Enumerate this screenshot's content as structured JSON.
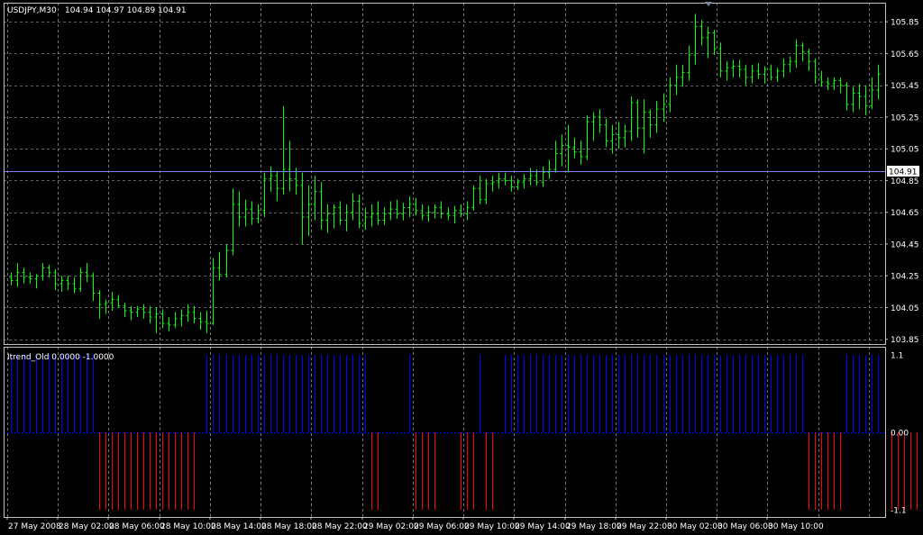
{
  "header": {
    "symbol_tf": "USDJPY,M30",
    "ohlc": "104.94 104.97 104.89 104.91"
  },
  "indicator": {
    "label": "Itrend_Old 0.0000 -1.0000"
  },
  "colors": {
    "background": "#000000",
    "grid": "#c0c0c0",
    "price_bars": "#00ff00",
    "up_histogram": "#0000ff",
    "down_histogram": "#ff0000",
    "bid_line": "#8080ff",
    "frame": "#c0c0c0"
  },
  "chart_data": [
    {
      "type": "ohlc",
      "current_price": "104.91",
      "y_ticks": [
        "105.85",
        "105.65",
        "105.45",
        "105.25",
        "105.05",
        "104.85",
        "104.65",
        "104.45",
        "104.25",
        "104.05",
        "103.85"
      ],
      "ylim": [
        103.82,
        105.97
      ],
      "x_ticks": [
        "27 May 2008",
        "28 May 02:00",
        "28 May 06:00",
        "28 May 10:00",
        "28 May 14:00",
        "28 May 18:00",
        "28 May 22:00",
        "29 May 02:00",
        "29 May 06:00",
        "29 May 10:00",
        "29 May 14:00",
        "29 May 18:00",
        "29 May 22:00",
        "30 May 02:00",
        "30 May 06:00",
        "30 May 10:00"
      ],
      "bars": [
        [
          104.24,
          104.27,
          104.19,
          104.22
        ],
        [
          104.22,
          104.33,
          104.18,
          104.27
        ],
        [
          104.27,
          104.3,
          104.2,
          104.24
        ],
        [
          104.24,
          104.27,
          104.2,
          104.23
        ],
        [
          104.23,
          104.26,
          104.17,
          104.25
        ],
        [
          104.25,
          104.33,
          104.22,
          104.3
        ],
        [
          104.3,
          104.32,
          104.24,
          104.27
        ],
        [
          104.27,
          104.29,
          104.16,
          104.2
        ],
        [
          104.2,
          104.25,
          104.15,
          104.22
        ],
        [
          104.22,
          104.25,
          104.16,
          104.2
        ],
        [
          104.2,
          104.24,
          104.14,
          104.17
        ],
        [
          104.17,
          104.3,
          104.15,
          104.27
        ],
        [
          104.27,
          104.33,
          104.21,
          104.25
        ],
        [
          104.25,
          104.27,
          104.09,
          104.14
        ],
        [
          104.14,
          104.16,
          103.98,
          104.07
        ],
        [
          104.07,
          104.1,
          104.01,
          104.08
        ],
        [
          104.08,
          104.15,
          104.03,
          104.1
        ],
        [
          104.1,
          104.13,
          104.05,
          104.06
        ],
        [
          104.06,
          104.08,
          103.99,
          104.03
        ],
        [
          104.03,
          104.06,
          103.97,
          104.02
        ],
        [
          104.02,
          104.06,
          103.99,
          104.04
        ],
        [
          104.04,
          104.07,
          103.98,
          104.02
        ],
        [
          104.02,
          104.06,
          103.95,
          103.99
        ],
        [
          103.99,
          104.05,
          103.89,
          104.01
        ],
        [
          104.01,
          104.04,
          103.92,
          103.95
        ],
        [
          103.95,
          103.99,
          103.9,
          103.94
        ],
        [
          103.94,
          104.02,
          103.92,
          103.98
        ],
        [
          103.98,
          104.04,
          103.93,
          104.0
        ],
        [
          104.0,
          104.07,
          103.96,
          104.02
        ],
        [
          104.02,
          104.06,
          103.95,
          103.98
        ],
        [
          103.98,
          104.02,
          103.91,
          103.96
        ],
        [
          103.96,
          104.03,
          103.89,
          103.95
        ],
        [
          103.95,
          104.36,
          103.94,
          104.3
        ],
        [
          104.3,
          104.4,
          104.22,
          104.26
        ],
        [
          104.26,
          104.45,
          104.24,
          104.41
        ],
        [
          104.41,
          104.8,
          104.38,
          104.7
        ],
        [
          104.7,
          104.78,
          104.56,
          104.62
        ],
        [
          104.62,
          104.73,
          104.56,
          104.67
        ],
        [
          104.67,
          104.72,
          104.57,
          104.61
        ],
        [
          104.61,
          104.7,
          104.58,
          104.66
        ],
        [
          104.66,
          104.9,
          104.62,
          104.86
        ],
        [
          104.86,
          104.94,
          104.78,
          104.88
        ],
        [
          104.88,
          104.91,
          104.72,
          104.8
        ],
        [
          104.8,
          105.32,
          104.76,
          104.92
        ],
        [
          104.92,
          105.1,
          104.78,
          104.86
        ],
        [
          104.86,
          104.93,
          104.76,
          104.82
        ],
        [
          104.82,
          104.9,
          104.45,
          104.62
        ],
        [
          104.62,
          104.82,
          104.5,
          104.7
        ],
        [
          104.7,
          104.88,
          104.6,
          104.78
        ],
        [
          104.78,
          104.84,
          104.54,
          104.6
        ],
        [
          104.6,
          104.7,
          104.52,
          104.64
        ],
        [
          104.64,
          104.7,
          104.55,
          104.68
        ],
        [
          104.68,
          104.72,
          104.57,
          104.6
        ],
        [
          104.6,
          104.7,
          104.53,
          104.65
        ],
        [
          104.65,
          104.77,
          104.6,
          104.72
        ],
        [
          104.72,
          104.76,
          104.55,
          104.58
        ],
        [
          104.58,
          104.68,
          104.54,
          104.62
        ],
        [
          104.62,
          104.7,
          104.56,
          104.64
        ],
        [
          104.64,
          104.72,
          104.57,
          104.6
        ],
        [
          104.6,
          104.68,
          104.57,
          104.64
        ],
        [
          104.64,
          104.72,
          104.6,
          104.67
        ],
        [
          104.67,
          104.73,
          104.61,
          104.64
        ],
        [
          104.64,
          104.71,
          104.6,
          104.68
        ],
        [
          104.68,
          104.75,
          104.62,
          104.7
        ],
        [
          104.7,
          104.74,
          104.63,
          104.66
        ],
        [
          104.66,
          104.7,
          104.6,
          104.63
        ],
        [
          104.63,
          104.69,
          104.59,
          104.65
        ],
        [
          104.65,
          104.7,
          104.61,
          104.68
        ],
        [
          104.68,
          104.72,
          104.61,
          104.64
        ],
        [
          104.64,
          104.68,
          104.6,
          104.63
        ],
        [
          104.63,
          104.69,
          104.58,
          104.66
        ],
        [
          104.66,
          104.7,
          104.62,
          104.64
        ],
        [
          104.64,
          104.72,
          104.6,
          104.68
        ],
        [
          104.68,
          104.82,
          104.66,
          104.8
        ],
        [
          104.8,
          104.88,
          104.7,
          104.73
        ],
        [
          104.73,
          104.86,
          104.7,
          104.83
        ],
        [
          104.83,
          104.88,
          104.78,
          104.84
        ],
        [
          104.84,
          104.9,
          104.8,
          104.86
        ],
        [
          104.86,
          104.9,
          104.82,
          104.85
        ],
        [
          104.85,
          104.88,
          104.78,
          104.81
        ],
        [
          104.81,
          104.86,
          104.79,
          104.84
        ],
        [
          104.84,
          104.89,
          104.8,
          104.86
        ],
        [
          104.86,
          104.93,
          104.82,
          104.88
        ],
        [
          104.88,
          104.92,
          104.82,
          104.84
        ],
        [
          104.84,
          104.94,
          104.81,
          104.9
        ],
        [
          104.9,
          104.98,
          104.86,
          104.92
        ],
        [
          104.92,
          105.1,
          104.9,
          105.02
        ],
        [
          105.02,
          105.14,
          104.94,
          105.07
        ],
        [
          105.07,
          105.2,
          104.9,
          105.06
        ],
        [
          105.06,
          105.12,
          104.99,
          105.03
        ],
        [
          105.03,
          105.1,
          104.95,
          105.0
        ],
        [
          105.0,
          105.26,
          104.98,
          105.22
        ],
        [
          105.22,
          105.28,
          105.1,
          105.25
        ],
        [
          105.25,
          105.3,
          105.15,
          105.2
        ],
        [
          105.2,
          105.24,
          105.06,
          105.1
        ],
        [
          105.1,
          105.2,
          105.02,
          105.14
        ],
        [
          105.14,
          105.22,
          105.05,
          105.12
        ],
        [
          105.12,
          105.2,
          105.06,
          105.16
        ],
        [
          105.16,
          105.38,
          105.1,
          105.34
        ],
        [
          105.34,
          105.36,
          105.12,
          105.18
        ],
        [
          105.18,
          105.36,
          105.02,
          105.28
        ],
        [
          105.28,
          105.3,
          105.12,
          105.2
        ],
        [
          105.2,
          105.35,
          105.15,
          105.3
        ],
        [
          105.3,
          105.4,
          105.22,
          105.33
        ],
        [
          105.33,
          105.5,
          105.28,
          105.45
        ],
        [
          105.45,
          105.58,
          105.39,
          105.5
        ],
        [
          105.5,
          105.58,
          105.44,
          105.53
        ],
        [
          105.53,
          105.7,
          105.48,
          105.64
        ],
        [
          105.64,
          105.9,
          105.58,
          105.82
        ],
        [
          105.82,
          105.86,
          105.7,
          105.75
        ],
        [
          105.75,
          105.82,
          105.62,
          105.78
        ],
        [
          105.78,
          105.8,
          105.64,
          105.68
        ],
        [
          105.68,
          105.72,
          105.5,
          105.54
        ],
        [
          105.54,
          105.6,
          105.48,
          105.56
        ],
        [
          105.56,
          105.61,
          105.5,
          105.57
        ],
        [
          105.57,
          105.61,
          105.5,
          105.55
        ],
        [
          105.55,
          105.58,
          105.45,
          105.5
        ],
        [
          105.5,
          105.58,
          105.46,
          105.54
        ],
        [
          105.54,
          105.59,
          105.49,
          105.52
        ],
        [
          105.52,
          105.57,
          105.46,
          105.55
        ],
        [
          105.55,
          105.58,
          105.48,
          105.5
        ],
        [
          105.5,
          105.56,
          105.47,
          105.54
        ],
        [
          105.54,
          105.62,
          105.5,
          105.58
        ],
        [
          105.58,
          105.63,
          105.53,
          105.6
        ],
        [
          105.6,
          105.74,
          105.56,
          105.7
        ],
        [
          105.7,
          105.72,
          105.6,
          105.66
        ],
        [
          105.66,
          105.68,
          105.54,
          105.6
        ],
        [
          105.6,
          105.62,
          105.46,
          105.5
        ],
        [
          105.5,
          105.54,
          105.44,
          105.47
        ],
        [
          105.47,
          105.5,
          105.42,
          105.46
        ],
        [
          105.46,
          105.5,
          105.42,
          105.48
        ],
        [
          105.48,
          105.5,
          105.4,
          105.45
        ],
        [
          105.45,
          105.47,
          105.29,
          105.33
        ],
        [
          105.33,
          105.44,
          105.28,
          105.4
        ],
        [
          105.4,
          105.46,
          105.3,
          105.38
        ],
        [
          105.38,
          105.45,
          105.26,
          105.32
        ],
        [
          105.32,
          105.5,
          105.3,
          105.42
        ],
        [
          105.42,
          105.58,
          105.36,
          105.52
        ]
      ],
      "trend": [
        1,
        1,
        1,
        1,
        1,
        1,
        1,
        1,
        1,
        1,
        1,
        1,
        1,
        1,
        -1,
        -1,
        -1,
        -1,
        -1,
        -1,
        -1,
        -1,
        -1,
        -1,
        -1,
        -1,
        -1,
        -1,
        -1,
        -1,
        0,
        1,
        1,
        1,
        1,
        1,
        1,
        1,
        1,
        1,
        1,
        1,
        1,
        1,
        1,
        1,
        1,
        1,
        1,
        1,
        1,
        1,
        1,
        1,
        1,
        1,
        1,
        -1,
        -1,
        0,
        0,
        0,
        0,
        1,
        -1,
        -1,
        -1,
        -1,
        0,
        0,
        0,
        -1,
        -1,
        -1,
        1,
        -1,
        -1,
        0,
        1,
        1,
        1,
        1,
        1,
        1,
        1,
        1,
        1,
        1,
        1,
        1,
        1,
        1,
        1,
        1,
        1,
        1,
        1,
        1,
        1,
        1,
        1,
        1,
        1,
        1,
        1,
        1,
        1,
        1,
        1,
        1,
        1,
        1,
        1,
        1,
        1,
        1,
        1,
        1,
        1,
        1,
        1,
        1,
        1,
        1,
        1,
        1,
        -1,
        -1,
        -1,
        -1,
        -1,
        -1,
        1,
        1,
        1,
        1,
        1,
        1,
        -1,
        -1,
        -1,
        -1,
        -1,
        -1,
        -1,
        -1,
        -1,
        -1,
        -1,
        -1
      ]
    },
    {
      "type": "bar",
      "y_ticks": [
        "1.1",
        "0.00",
        "-1.1"
      ],
      "ylim": [
        -1.1,
        1.1
      ]
    }
  ]
}
